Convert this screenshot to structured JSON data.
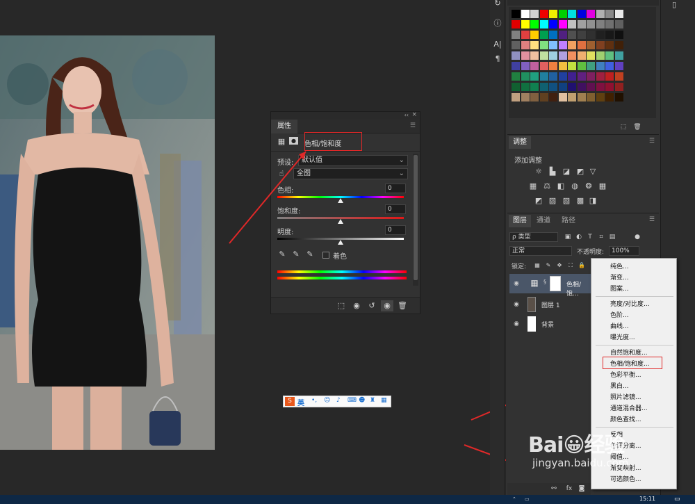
{
  "properties_panel": {
    "tab_label": "属性",
    "adjustment_name": "色相/饱和度",
    "preset_label": "预设:",
    "preset_value": "默认值",
    "channel_value": "全图",
    "hue_label": "色相:",
    "hue_value": "0",
    "saturation_label": "饱和度:",
    "saturation_value": "0",
    "lightness_label": "明度:",
    "lightness_value": "0",
    "colorize_label": "着色"
  },
  "adjustments_panel": {
    "tab_label": "调整",
    "add_label": "添加调整"
  },
  "layers_panel": {
    "tabs": [
      "图层",
      "通道",
      "路径"
    ],
    "filter_label": "ρ 类型",
    "blend_mode": "正常",
    "opacity_label": "不透明度:",
    "opacity_value": "100%",
    "lock_label": "锁定:",
    "layers": [
      {
        "name": "色相/饱..."
      },
      {
        "name": "图层 1"
      },
      {
        "name": "背景"
      }
    ]
  },
  "context_menu": {
    "groups": [
      [
        "纯色...",
        "渐变...",
        "图案..."
      ],
      [
        "亮度/对比度...",
        "色阶...",
        "曲线...",
        "曝光度..."
      ],
      [
        "自然饱和度...",
        "色相/饱和度...",
        "色彩平衡...",
        "黑白...",
        "照片滤镜...",
        "通道混合器...",
        "颜色查找..."
      ],
      [
        "反相",
        "色调分离...",
        "阈值...",
        "渐变映射...",
        "可选颜色..."
      ]
    ]
  },
  "ime_bar": {
    "lang": "英"
  },
  "taskbar": {
    "time": "15:11"
  },
  "watermark": {
    "logo": "Bai😀经验",
    "url": "jingyan.baidu.com"
  },
  "colors": {
    "annotation_red": "#e02828",
    "panel_bg": "#323232",
    "workspace_bg": "#282828",
    "menu_bg": "#f0f0f0"
  }
}
